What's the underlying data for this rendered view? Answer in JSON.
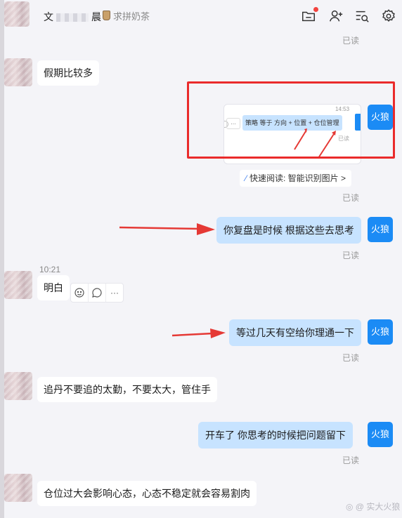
{
  "header": {
    "contact_name_prefix": "文",
    "contact_name_suffix": "晨",
    "status_text": "求拼奶茶",
    "icons": [
      "folder-icon",
      "add-user-icon",
      "search-history-icon",
      "gear-icon"
    ]
  },
  "self": {
    "avatar_label": "火狼"
  },
  "read_label": "已读",
  "messages": {
    "m1_text": "假期比较多",
    "img_card": {
      "time": "14:53",
      "bubble_text": "策略  等于  方向 + 位置 + 仓位管理",
      "read": "已读",
      "dots": "…"
    },
    "quick_read": "快速阅读: 智能识别图片 >",
    "m2_text": "你复盘是时候 根据这些去思考",
    "m3_time": "10:21",
    "m3_text": "明白",
    "m3_actions": {
      "more": "···"
    },
    "m4_text": "等过几天有空给你理通一下",
    "m5_text": "追丹不要追的太勤，不要太大，管住手",
    "m6_text": "开车了    你思考的时候把问题留下",
    "m7_text": "仓位过大会影响心态，心态不稳定就会容易割肉"
  },
  "watermark": "◎ @ 实大火狼",
  "colors": {
    "annotation_red": "#ea2b2b",
    "self_avatar_blue": "#1b8bf5",
    "outgoing_bubble": "#c7e3ff",
    "background": "#f4f4f8"
  }
}
